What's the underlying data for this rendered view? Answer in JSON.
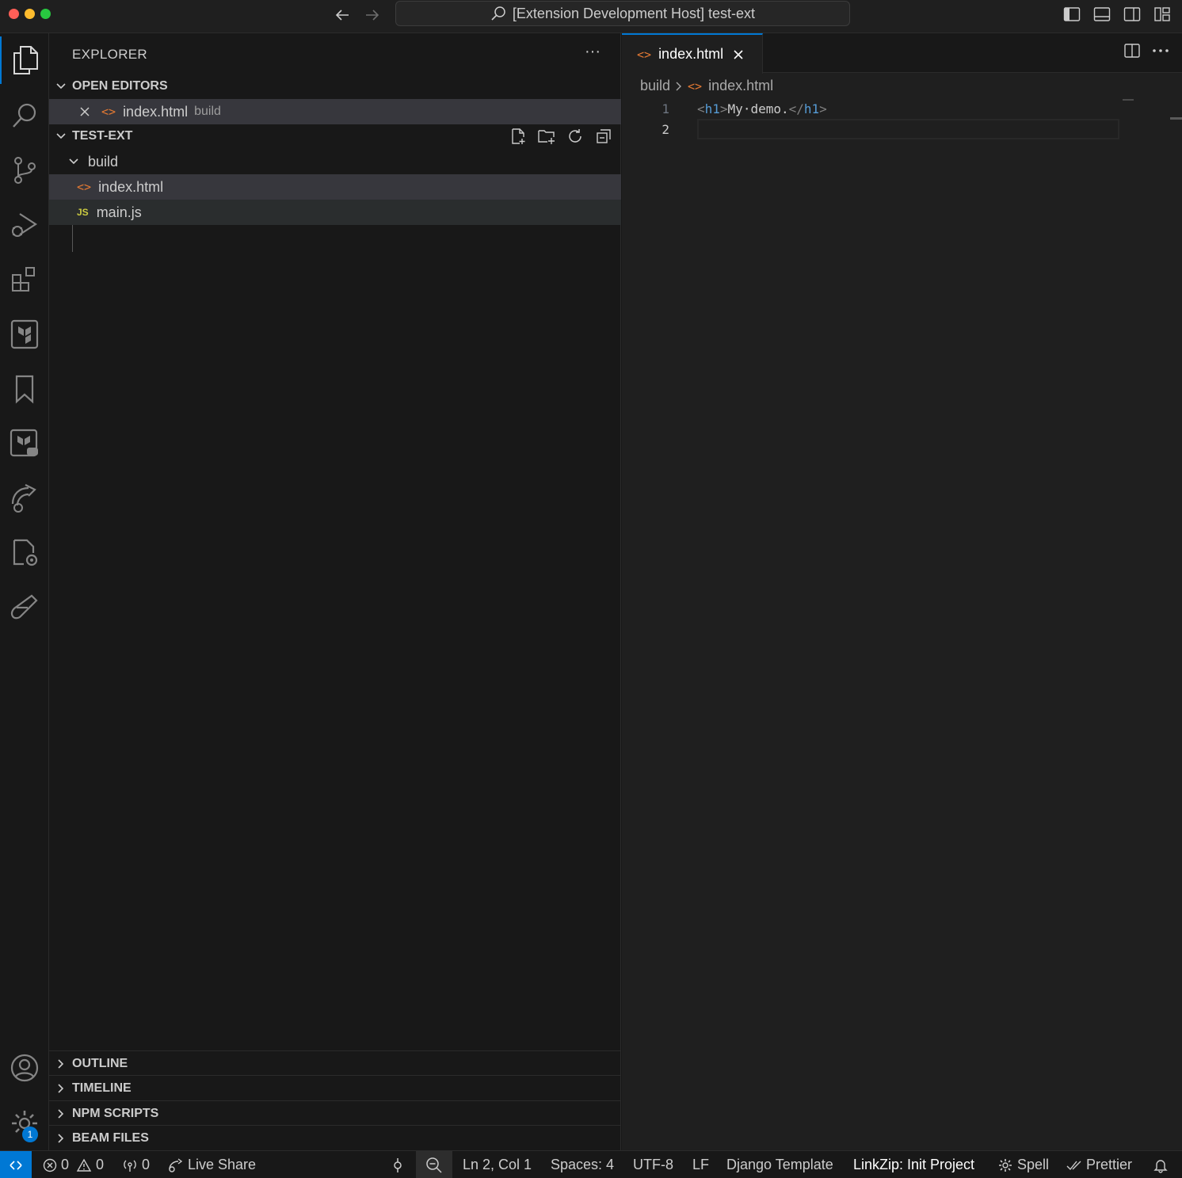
{
  "window": {
    "title": "[Extension Development Host] test-ext"
  },
  "sidebar": {
    "title": "EXPLORER",
    "more_label": "···",
    "open_editors": {
      "label": "OPEN EDITORS",
      "items": [
        {
          "name": "index.html",
          "description": "build"
        }
      ]
    },
    "workspace": {
      "label": "TEST-EXT",
      "folder": "build",
      "files": [
        {
          "name": "index.html",
          "type": "html"
        },
        {
          "name": "main.js",
          "type": "js"
        }
      ]
    },
    "bottom_sections": [
      "OUTLINE",
      "TIMELINE",
      "NPM SCRIPTS",
      "BEAM FILES"
    ]
  },
  "activity": {
    "settings_badge": "1"
  },
  "editor": {
    "tab_label": "index.html",
    "breadcrumb": {
      "folder": "build",
      "file": "index.html"
    },
    "line_numbers": [
      "1",
      "2"
    ],
    "code_line_1": {
      "open_tag_open": "<",
      "open_tag_name": "h1",
      "open_tag_close": ">",
      "text": "My·demo.",
      "close_tag_open": "</",
      "close_tag_name": "h1",
      "close_tag_close": ">"
    }
  },
  "statusbar": {
    "errors": "0",
    "warnings": "0",
    "ports": "0",
    "live_share": "Live Share",
    "cursor_position": "Ln 2, Col 1",
    "indentation": "Spaces: 4",
    "encoding": "UTF-8",
    "eol": "LF",
    "language": "Django Template",
    "linkzip": "LinkZip: Init Project",
    "spell": "Spell",
    "prettier": "Prettier"
  },
  "colors": {
    "accent": "#0078d4",
    "html_icon": "#e37933",
    "js_icon": "#cbcb41",
    "tag_name": "#569cd6"
  }
}
